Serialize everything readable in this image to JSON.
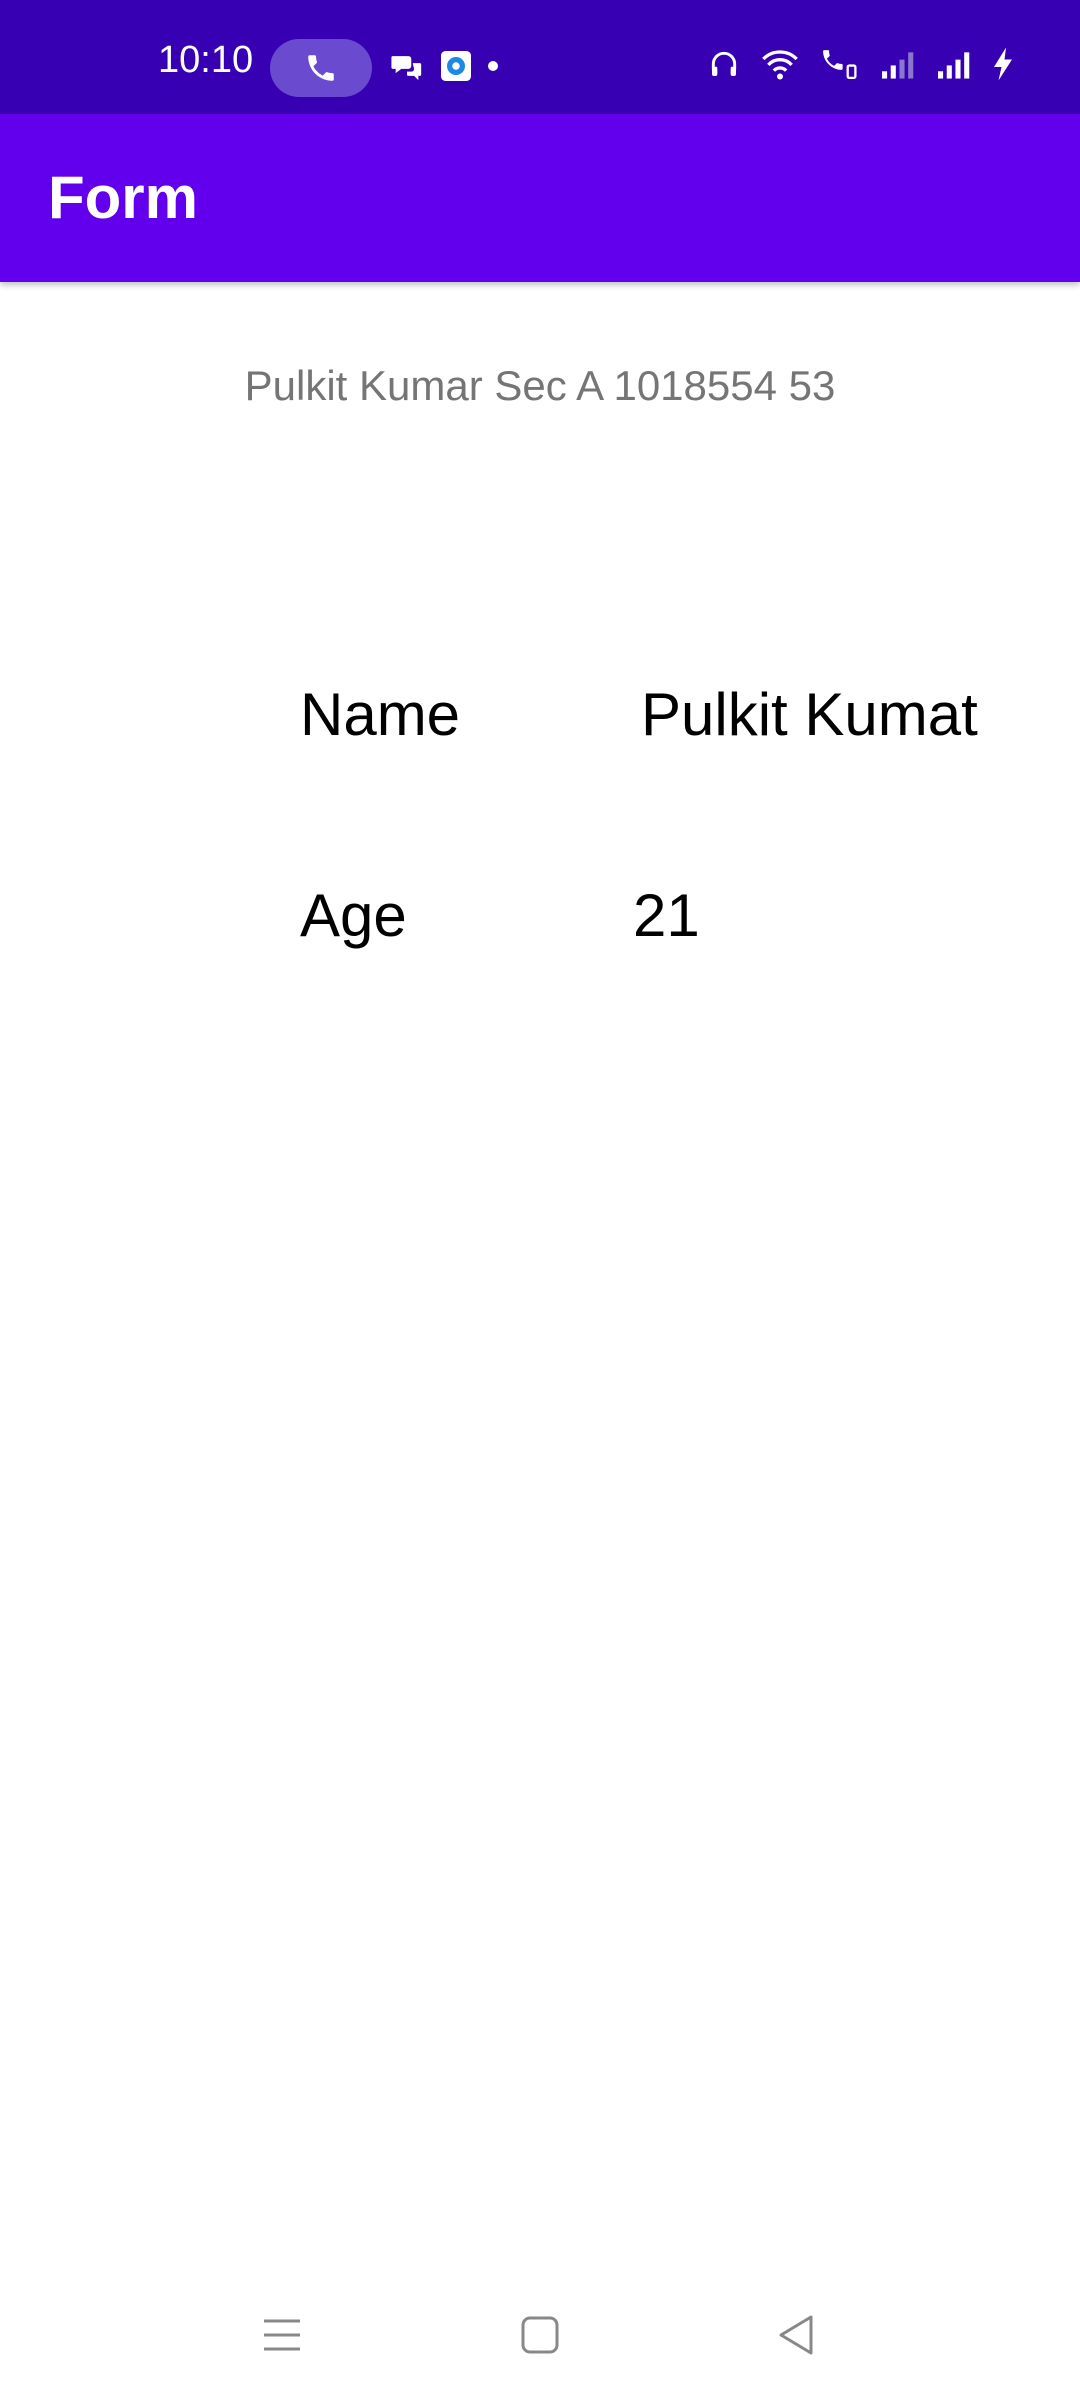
{
  "status_bar": {
    "time": "10:10",
    "icons_left": [
      "phone-call-icon",
      "chat-icon",
      "app-notification-icon",
      "dot-icon"
    ],
    "icons_right": [
      "headphones-icon",
      "wifi-icon",
      "wifi-calling-icon",
      "signal-weak-icon",
      "signal-full-icon",
      "charging-icon"
    ]
  },
  "app_bar": {
    "title": "Form",
    "color": "#6200EE"
  },
  "subtitle": "Pulkit Kumar Sec A 1018554  53",
  "form": {
    "name_label": "Name",
    "name_value": "Pulkit Kumat",
    "age_label": "Age",
    "age_value": "21"
  },
  "nav_bar": {
    "buttons": [
      "menu-icon",
      "home-icon",
      "back-icon"
    ]
  },
  "colors": {
    "status_bar": "#3700B3",
    "app_bar": "#6200EE",
    "subtitle": "#757575"
  }
}
